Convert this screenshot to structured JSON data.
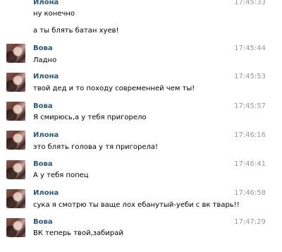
{
  "messages": [
    {
      "sender": "Илона",
      "time": "17:45:33",
      "lines": [
        "ну конечно",
        "а ты блять батан хуев!"
      ]
    },
    {
      "sender": "Вова",
      "time": "17:45:44",
      "lines": [
        "Ладно"
      ]
    },
    {
      "sender": "Илона",
      "time": "17:45:53",
      "lines": [
        "твой дед и то походу современней чем ты!"
      ]
    },
    {
      "sender": "Вова",
      "time": "17:45:57",
      "lines": [
        "Я смирюсь,а у тебя пригорело"
      ]
    },
    {
      "sender": "Илона",
      "time": "17:46:16",
      "lines": [
        "это блять голова у тя пригорела!"
      ]
    },
    {
      "sender": "Вова",
      "time": "17:46:41",
      "lines": [
        "А у тебя попец"
      ]
    },
    {
      "sender": "Илона",
      "time": "17:46:58",
      "lines": [
        "сука я смотрю ты ваще лох ебанутый-уеби с вк тварь!!"
      ]
    },
    {
      "sender": "Вова",
      "time": "17:47:29",
      "lines": [
        "ВК теперь твой,забирай"
      ]
    }
  ]
}
